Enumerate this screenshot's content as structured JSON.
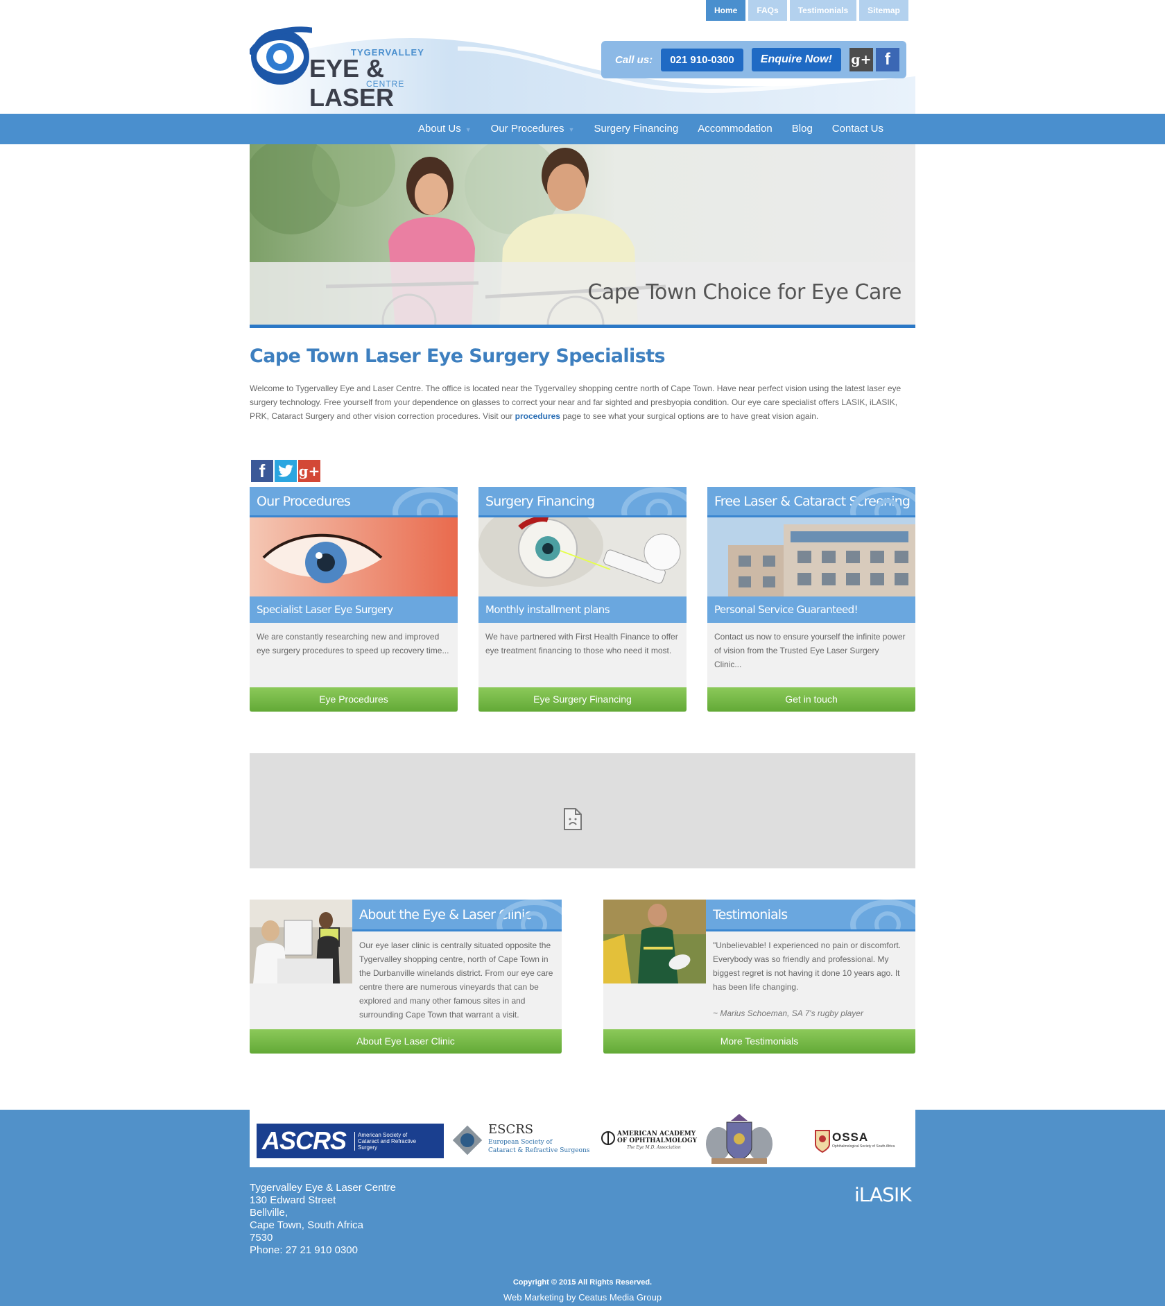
{
  "topnav": {
    "items": [
      "Home",
      "FAQs",
      "Testimonials",
      "Sitemap"
    ]
  },
  "logo": {
    "line1": "TYGERVALLEY",
    "line2": "EYE & LASER",
    "line3": "CENTRE"
  },
  "callbox": {
    "label": "Call us:",
    "phone": "021 910-0300",
    "enquire": "Enquire Now!",
    "gplus": "g+",
    "facebook": "f"
  },
  "mainnav": {
    "items": [
      "About Us",
      "Our Procedures",
      "Surgery Financing",
      "Accommodation",
      "Blog",
      "Contact Us"
    ],
    "caret": "▼"
  },
  "hero": {
    "caption": "Cape Town Choice for Eye Care"
  },
  "intro": {
    "title": "Cape Town Laser Eye Surgery Specialists",
    "text_before": "Welcome to Tygervalley Eye and Laser Centre. The office is located near the Tygervalley shopping centre north of Cape Town. Have near perfect vision using the latest laser eye surgery technology. Free yourself from your dependence on glasses to correct your near and far sighted and presbyopia condition. Our eye care specialist offers LASIK, iLASIK, PRK, Cataract Surgery and other vision correction procedures. Visit our ",
    "link": "procedures",
    "text_after": " page to see what your surgical options are to have great vision again."
  },
  "share": {
    "facebook": "f",
    "twitter": "t",
    "gplus": "g+"
  },
  "cards": [
    {
      "title": "Our Procedures",
      "subtitle": "Specialist Laser Eye Surgery",
      "text": "We are constantly researching new and improved eye surgery procedures to speed up recovery time...",
      "button": "Eye Procedures"
    },
    {
      "title": "Surgery Financing",
      "subtitle": "Monthly installment plans",
      "text": "We have partnered with First Health Finance to offer eye treatment financing to those who need it most.",
      "button": "Eye Surgery Financing"
    },
    {
      "title": "Free Laser & Cataract Screening",
      "subtitle": "Personal Service Guaranteed!",
      "text": "Contact us now to ensure yourself the infinite power of vision from the Trusted Eye Laser Surgery Clinic...",
      "button": "Get in touch"
    }
  ],
  "about": {
    "title": "About the Eye & Laser Clinic",
    "text": "Our eye laser clinic is centrally situated opposite the Tygervalley shopping centre, north of Cape Town in the Durbanville winelands district. From our eye care centre there are numerous vineyards that can be explored and many other famous sites in and surrounding Cape Town that warrant a visit.",
    "button": "About Eye Laser Clinic"
  },
  "testimonials": {
    "title": "Testimonials",
    "quote": "\"Unbelievable! I experienced no pain or discomfort. Everybody was so friendly and professional. My biggest regret is not having it done 10 years ago. It has been life changing.",
    "author": "~ Marius Schoeman, SA 7's rugby player",
    "button": "More Testimonials"
  },
  "partners": {
    "ascrs": "ASCRS",
    "ascrs_sub": "American Society of Cataract and Refractive Surgery",
    "escrs": "ESCRS",
    "escrs_sub1": "European Society of",
    "escrs_sub2": "Cataract & Refractive Surgeons",
    "aao1": "AMERICAN ACADEMY",
    "aao2": "OF OPHTHALMOLOGY",
    "aao3": "The Eye M.D. Association",
    "ossa": "OSSA",
    "ossa_sub": "Ophthalmological Society of South Africa"
  },
  "footer": {
    "address": [
      "Tygervalley Eye & Laser Centre",
      "130 Edward Street",
      "Bellville,",
      "Cape Town, South Africa",
      "7530",
      "Phone: 27 21 910 0300"
    ],
    "ilasik": "iLASIK",
    "copyright": "Copyright © 2015 All Rights Reserved.",
    "credit": "Web Marketing by Ceatus Media Group"
  },
  "colors": {
    "primary": "#4a8fce",
    "card_head": "#6aa7df",
    "button_green": "#62a936",
    "footer": "#5191c9"
  }
}
